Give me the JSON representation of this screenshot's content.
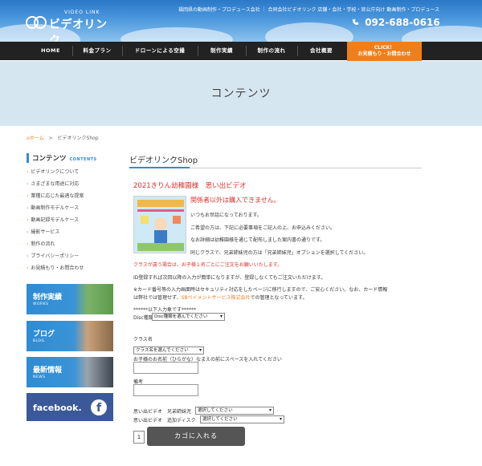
{
  "header": {
    "logo_sub": "VIDEO LINK",
    "logo_text": "ビデオリンク",
    "description": "福岡県の動画制作・プロデュース会社 ｜ 合同会社ビデオリンク  店舗・会社・学校・官公庁向け 動画制作・プロデュース",
    "phone": "092-688-0616"
  },
  "nav": {
    "items": [
      "HOME",
      "料金プラン",
      "ドローンによる空撮",
      "制作実績",
      "制作の流れ",
      "会社概要"
    ],
    "cta_line1": "CLICK！",
    "cta_line2": "お見積もり・お問合わせ"
  },
  "page_title": "コンテンツ",
  "breadcrumb": {
    "home": "ホーム",
    "separator": ">",
    "current": "ビデオリンクShop"
  },
  "sidebar": {
    "heading": "コンテンツ",
    "heading_en": "CONTENTS",
    "links": [
      "ビデオリンクについて",
      "さまざまな用途に対応",
      "業種に応じた最適な提案",
      "動画制作モデルケース",
      "動画記録モデルケース",
      "撮影サービス",
      "制作の流れ",
      "プライバシーポリシー",
      "お見積もり・お問合わせ"
    ],
    "banners": [
      {
        "label": "制作実績",
        "en": "WORKS"
      },
      {
        "label": "ブログ",
        "en": "BLOG"
      },
      {
        "label": "最新情報",
        "en": "NEWS"
      }
    ],
    "facebook": "facebook.",
    "facebook_icon": "f"
  },
  "main": {
    "title": "ビデオリンクShop",
    "product_title": "2021きりん幼稚園様　思い出ビデオ",
    "warning": "関係者以外は購入できません。",
    "p1": "いつもお世話になっております。",
    "p2": "ご希望の方は、下記に必要事項をご記入の上、お申込みください。",
    "p3": "なお詳細は幼稚園様を通じて配布しました案内書の通りです。",
    "p4": "同じクラスで、兄弟姉妹児の方は「兄弟姉妹児」オプションを選択してください。",
    "p5": "クラスが違う場合は、お子様１名ごとにご注文をお願いいたします。",
    "p6": "ID登録すれば次回以降の入力が簡単になりますが、登録しなくてもご注文いただけます。",
    "p7": "※カード番号等の入力画面時はセキュリティ対応をしたページに移行しますので、ご安心ください。なお、カード情報",
    "p8_pre": "は弊社では管理せず、",
    "p8_link": "SBペイメントサービス株式会社",
    "p8_post": "での管理となっています。",
    "divider_note": "******以下入力象です******",
    "disc_label": "Disc種類",
    "disc_select": "Disc種類を選んでください",
    "class_label": "クラス名",
    "class_select": "クラス名を選んでください",
    "child_name_label": "お子様のお名前（ひらがな）なまえの前にスペースを入れてください",
    "note_label": "備考",
    "opt1_label": "思い出ビデオ　兄弟姉妹児",
    "opt1_select": "選択してください",
    "opt2_label": "思い出ビデオ　追加ディスク",
    "opt2_select": "選択してください",
    "qty": "1",
    "cart_button": "カゴに入れる"
  }
}
